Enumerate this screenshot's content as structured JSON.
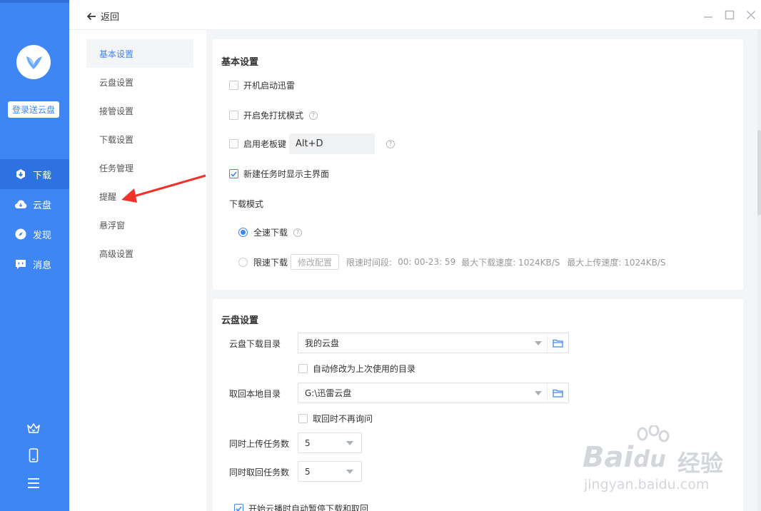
{
  "rail": {
    "login_label": "登录送云盘",
    "nav": [
      {
        "label": "下载",
        "icon": "download-icon",
        "active": true
      },
      {
        "label": "云盘",
        "icon": "cloud-icon",
        "active": false
      },
      {
        "label": "发现",
        "icon": "compass-icon",
        "active": false
      },
      {
        "label": "消息",
        "icon": "message-icon",
        "active": false
      }
    ],
    "bottom_icons": [
      "crown-icon",
      "phone-icon",
      "menu-icon"
    ]
  },
  "titlebar": {
    "back_label": "返回"
  },
  "side": {
    "items": [
      {
        "label": "基本设置",
        "active": true
      },
      {
        "label": "云盘设置"
      },
      {
        "label": "接管设置"
      },
      {
        "label": "下载设置"
      },
      {
        "label": "任务管理"
      },
      {
        "label": "提醒"
      },
      {
        "label": "悬浮窗"
      },
      {
        "label": "高级设置"
      }
    ]
  },
  "basic": {
    "title": "基本设置",
    "startup": {
      "label": "开机启动迅雷",
      "checked": false
    },
    "dnd": {
      "label": "开启免打扰模式",
      "checked": false
    },
    "boss_key": {
      "label": "启用老板键",
      "checked": false,
      "value": "Alt+D"
    },
    "show_main": {
      "label": "新建任务时显示主界面",
      "checked": true
    },
    "mode_title": "下载模式",
    "full_speed": {
      "label": "全速下载",
      "selected": true
    },
    "limit_speed": {
      "label": "限速下载",
      "selected": false,
      "modify_label": "修改配置",
      "time_label": "限速时间段:",
      "time_value": "00: 00-23: 59",
      "max_down": "最大下载速度: 1024KB/S",
      "max_up": "最大上传速度: 1024KB/S"
    }
  },
  "cloud": {
    "title": "云盘设置",
    "download_dir_label": "云盘下载目录",
    "download_dir_value": "我的云盘",
    "auto_modify": {
      "label": "自动修改为上次使用的目录",
      "checked": false
    },
    "local_dir_label": "取回本地目录",
    "local_dir_value": "G:\\迅雷云盘",
    "no_ask": {
      "label": "取回时不再询问",
      "checked": false
    },
    "upload_tasks_label": "同时上传任务数",
    "upload_tasks_value": "5",
    "retrieve_tasks_label": "同时取回任务数",
    "retrieve_tasks_value": "5",
    "auto_pause": {
      "label": "开始云播时自动暂停下载和取回",
      "checked": true
    }
  },
  "watermark": {
    "brand": "Bai",
    "brand2": "du",
    "cn": "经验",
    "url": "jingyan.baidu.com"
  },
  "colors": {
    "accent": "#3f86f5",
    "rail": "#3f86f5",
    "arrow": "#f0322a"
  }
}
